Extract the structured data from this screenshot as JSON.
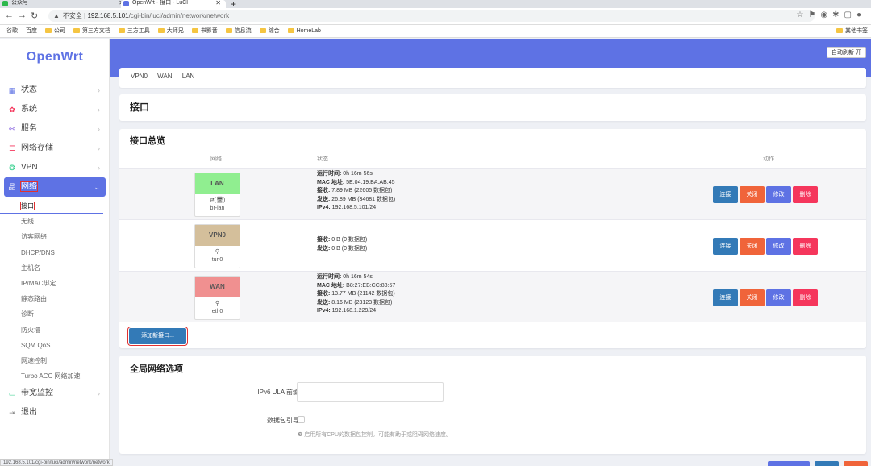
{
  "browser": {
    "tabs": [
      {
        "label": "公众号"
      },
      {
        "label": "OpenWrt - 接口 - LuCI"
      }
    ],
    "url_warning": "不安全",
    "url_host": "192.168.5.101",
    "url_path": "/cgi-bin/luci/admin/network/network",
    "bookmarks": [
      "谷歌",
      "百度",
      "公司",
      "第三方文档",
      "三方工具",
      "大师兄",
      "书影音",
      "信息流",
      "综合",
      "HomeLab"
    ],
    "bookmarks_right": "其他书签",
    "status_url": "192.168.5.101/cgi-bin/luci/admin/network/network"
  },
  "sidebar": {
    "logo": "OpenWrt",
    "items": [
      {
        "label": "状态",
        "icon": "dashboard-icon"
      },
      {
        "label": "系统",
        "icon": "gear-icon"
      },
      {
        "label": "服务",
        "icon": "services-icon"
      },
      {
        "label": "网络存储",
        "icon": "storage-icon"
      },
      {
        "label": "VPN",
        "icon": "vpn-icon"
      },
      {
        "label": "网络",
        "icon": "network-icon"
      },
      {
        "label": "带宽监控",
        "icon": "monitor-icon"
      },
      {
        "label": "退出",
        "icon": "logout-icon"
      }
    ],
    "network_sub": [
      "接口",
      "无线",
      "访客网络",
      "DHCP/DNS",
      "主机名",
      "IP/MAC绑定",
      "静态路由",
      "诊断",
      "防火墙",
      "SQM QoS",
      "网速控制",
      "Turbo ACC 网络加速"
    ]
  },
  "header": {
    "autorefresh": "自动刷新 开"
  },
  "tabs": [
    "VPN0",
    "WAN",
    "LAN"
  ],
  "page_title": "接口",
  "overview": {
    "title": "接口总览",
    "columns": [
      "网络",
      "状态",
      "动作"
    ],
    "rows": [
      {
        "name": "LAN",
        "color": "#90ee90",
        "device_icon": "⇄",
        "device": "br-lan",
        "device_extra": "(🖥)",
        "status": [
          "运行时间:",
          " 0h 16m 56s",
          "MAC 地址:",
          " 5E:04:19:BA:AB:45",
          "接收:",
          " 7.89 MB (22605 数据包)",
          "发送:",
          " 26.89 MB (34681 数据包)",
          "IPv4:",
          " 192.168.5.101/24"
        ]
      },
      {
        "name": "VPN0",
        "color": "#d4bf9b",
        "device_icon": "⚲",
        "device": "tun0",
        "device_extra": "",
        "status": [
          "接收:",
          " 0 B (0 数据包)",
          "发送:",
          " 0 B (0 数据包)"
        ]
      },
      {
        "name": "WAN",
        "color": "#f09090",
        "device_icon": "⚲",
        "device": "eth0",
        "device_extra": "",
        "status": [
          "运行时间:",
          " 0h 16m 54s",
          "MAC 地址:",
          " B8:27:EB:CC:88:57",
          "接收:",
          " 13.77 MB (21142 数据包)",
          "发送:",
          " 8.16 MB (23123 数据包)",
          "IPv4:",
          " 192.168.1.229/24"
        ]
      }
    ],
    "actions": {
      "connect": "连接",
      "stop": "关闭",
      "edit": "修改",
      "delete": "删除"
    },
    "add_button": "添加新接口..."
  },
  "global": {
    "title": "全局网络选项",
    "ula_label": "IPv6 ULA 前缀",
    "ula_value": "",
    "sniff_label": "数据包引导",
    "hint": "❷ 启用所有CPU的数据包控制。可能有助于或阻碍网络速度。"
  }
}
